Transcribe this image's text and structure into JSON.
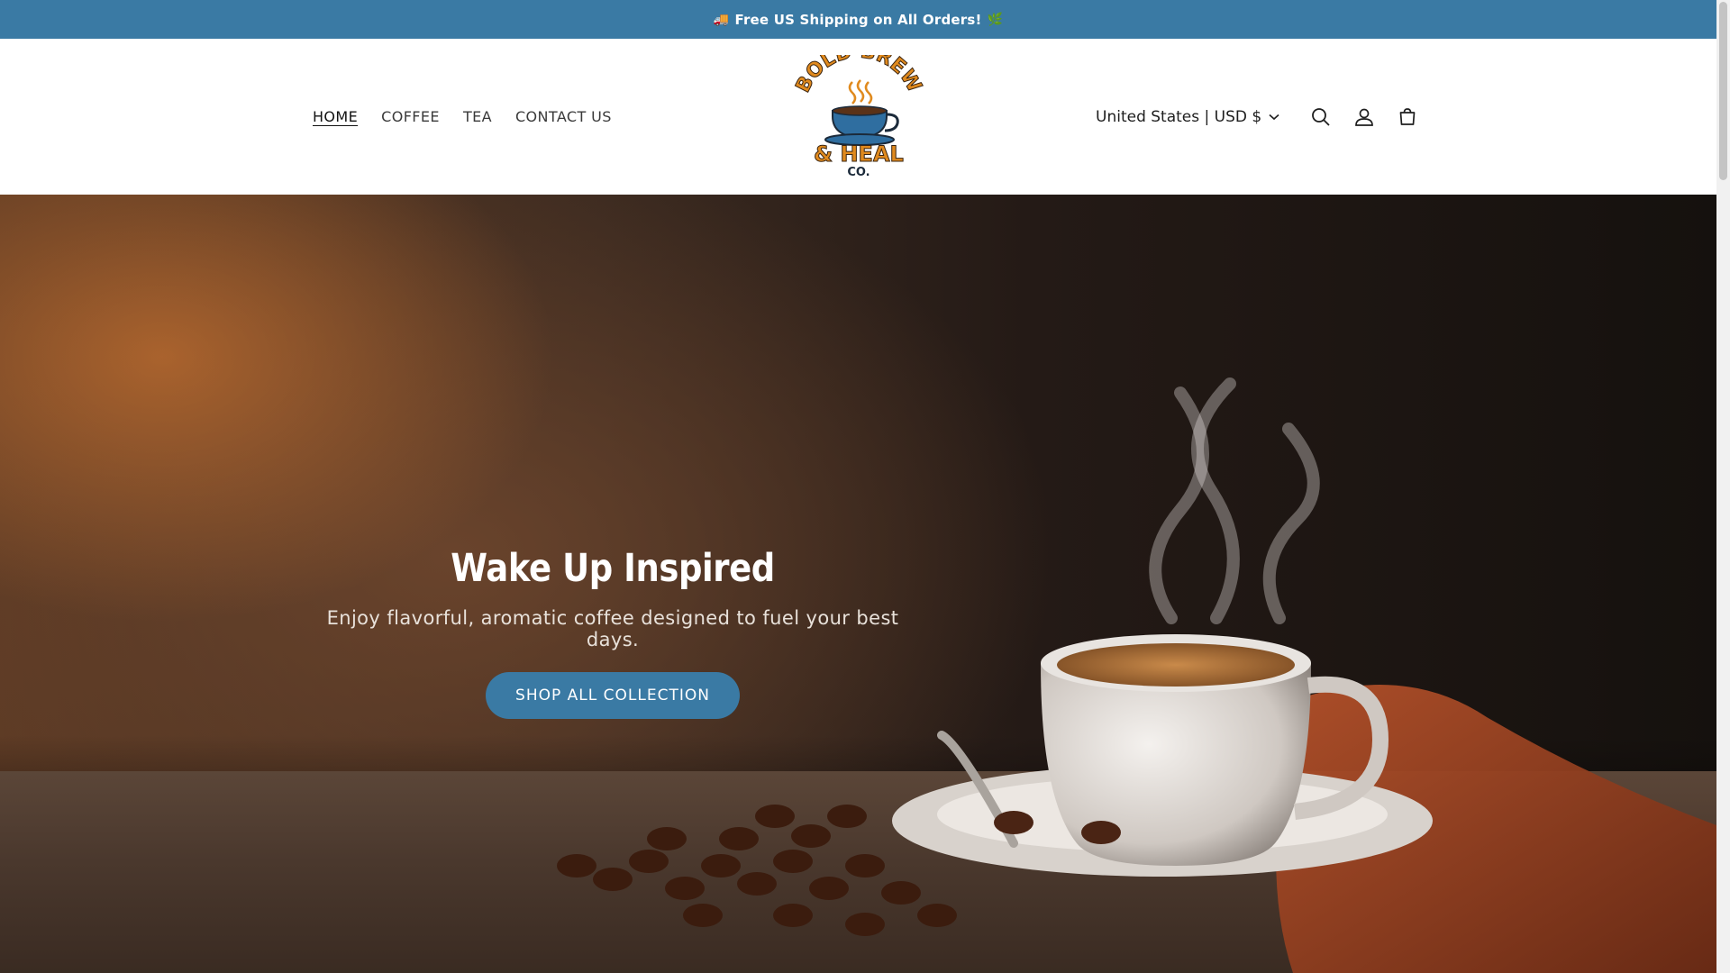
{
  "announcement": {
    "text": "Free US Shipping on All Orders!",
    "leading_icon": "truck-icon",
    "trailing_icon": "leaf-icon"
  },
  "nav": {
    "items": [
      {
        "label": "HOME",
        "active": true
      },
      {
        "label": "COFFEE",
        "active": false
      },
      {
        "label": "TEA",
        "active": false
      },
      {
        "label": "CONTACT US",
        "active": false
      }
    ]
  },
  "logo": {
    "line1": "BOLD BREW",
    "line2": "& HEAL",
    "line3": "CO."
  },
  "header": {
    "country_selector": "United States | USD $",
    "icons": [
      "search-icon",
      "account-icon",
      "cart-icon"
    ]
  },
  "hero": {
    "title": "Wake Up Inspired",
    "subtitle": "Enjoy flavorful, aromatic coffee designed to fuel your best days.",
    "button_label": "SHOP ALL COLLECTION"
  },
  "colors": {
    "accent": "#3a7aa4",
    "logo_orange": "#e08a1e",
    "logo_blue": "#2f6ea0"
  }
}
